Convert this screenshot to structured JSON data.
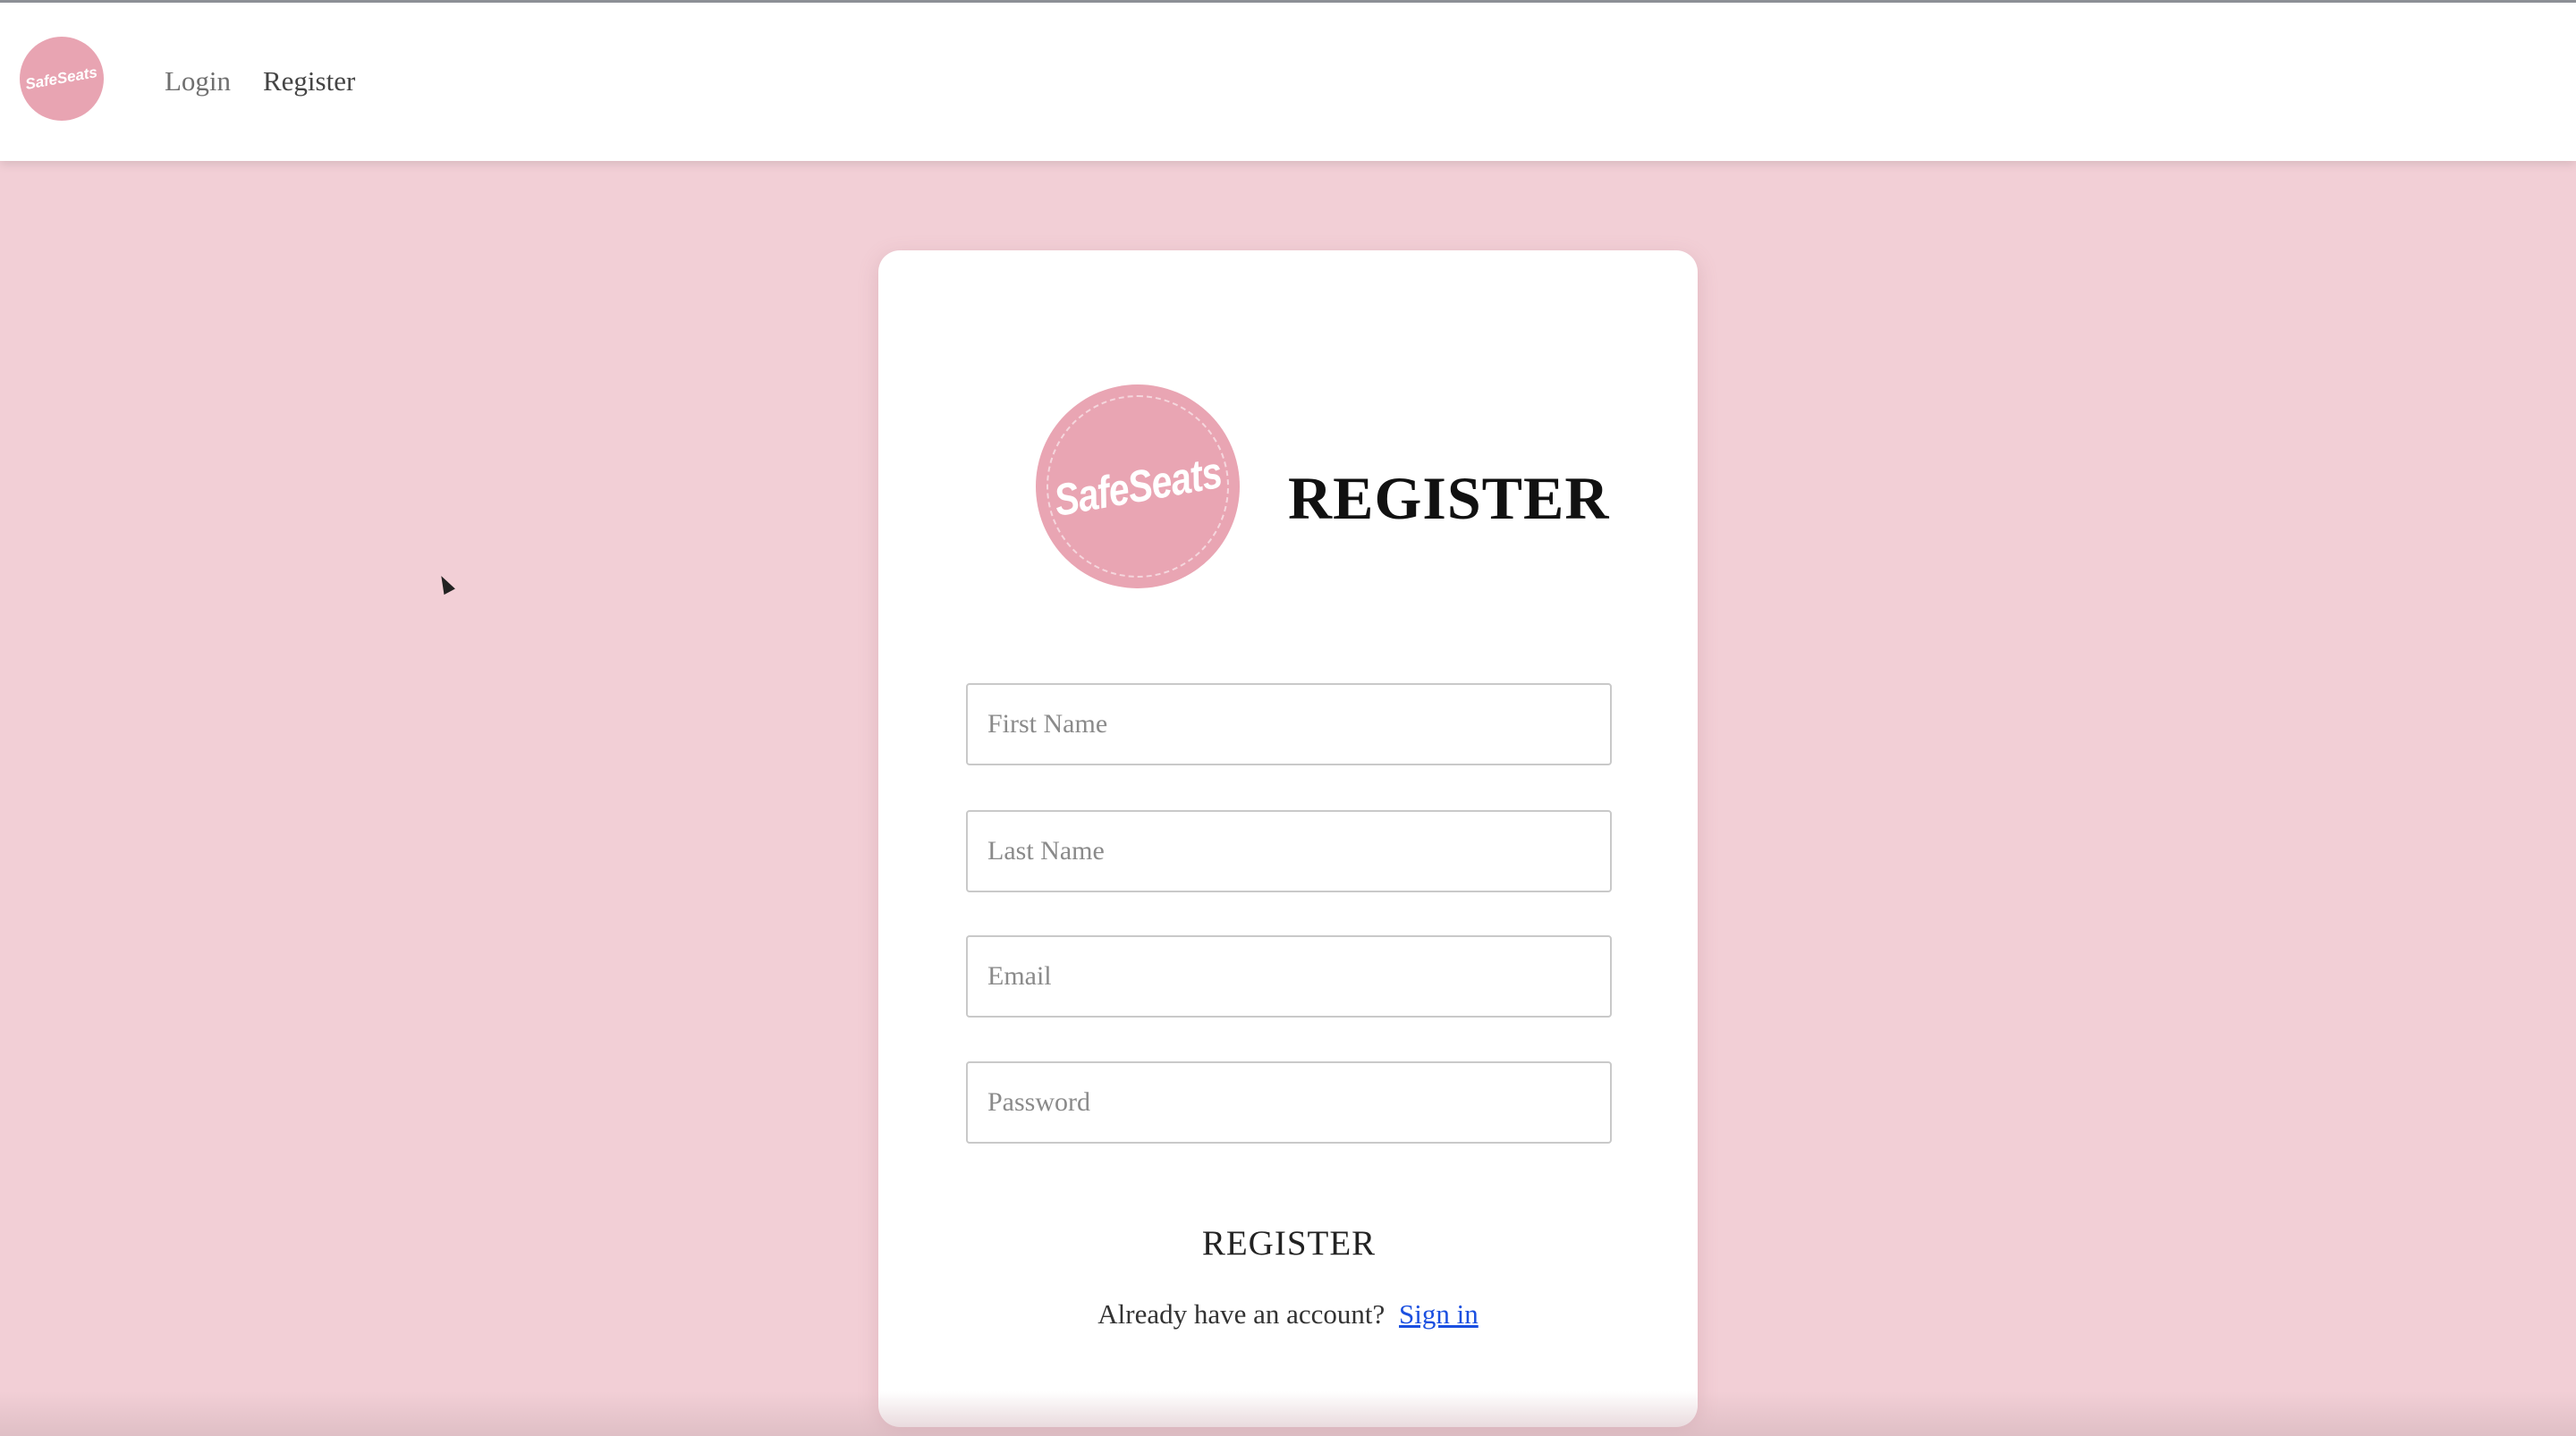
{
  "nav": {
    "logo_text": "SafeSeats",
    "links": [
      {
        "label": "Login"
      },
      {
        "label": "Register"
      }
    ]
  },
  "card": {
    "logo_text": "SafeSeats",
    "title": "REGISTER",
    "fields": {
      "first_name": {
        "placeholder": "First Name",
        "value": ""
      },
      "last_name": {
        "placeholder": "Last Name",
        "value": ""
      },
      "email": {
        "placeholder": "Email",
        "value": ""
      },
      "password": {
        "placeholder": "Password",
        "value": ""
      }
    },
    "submit_label": "REGISTER",
    "signin_prompt": "Already have an account?",
    "signin_link": "Sign in"
  },
  "colors": {
    "page_background": "#f2cfd6",
    "brand_pink": "#e9a5b3",
    "link_blue": "#1a4fe0"
  }
}
